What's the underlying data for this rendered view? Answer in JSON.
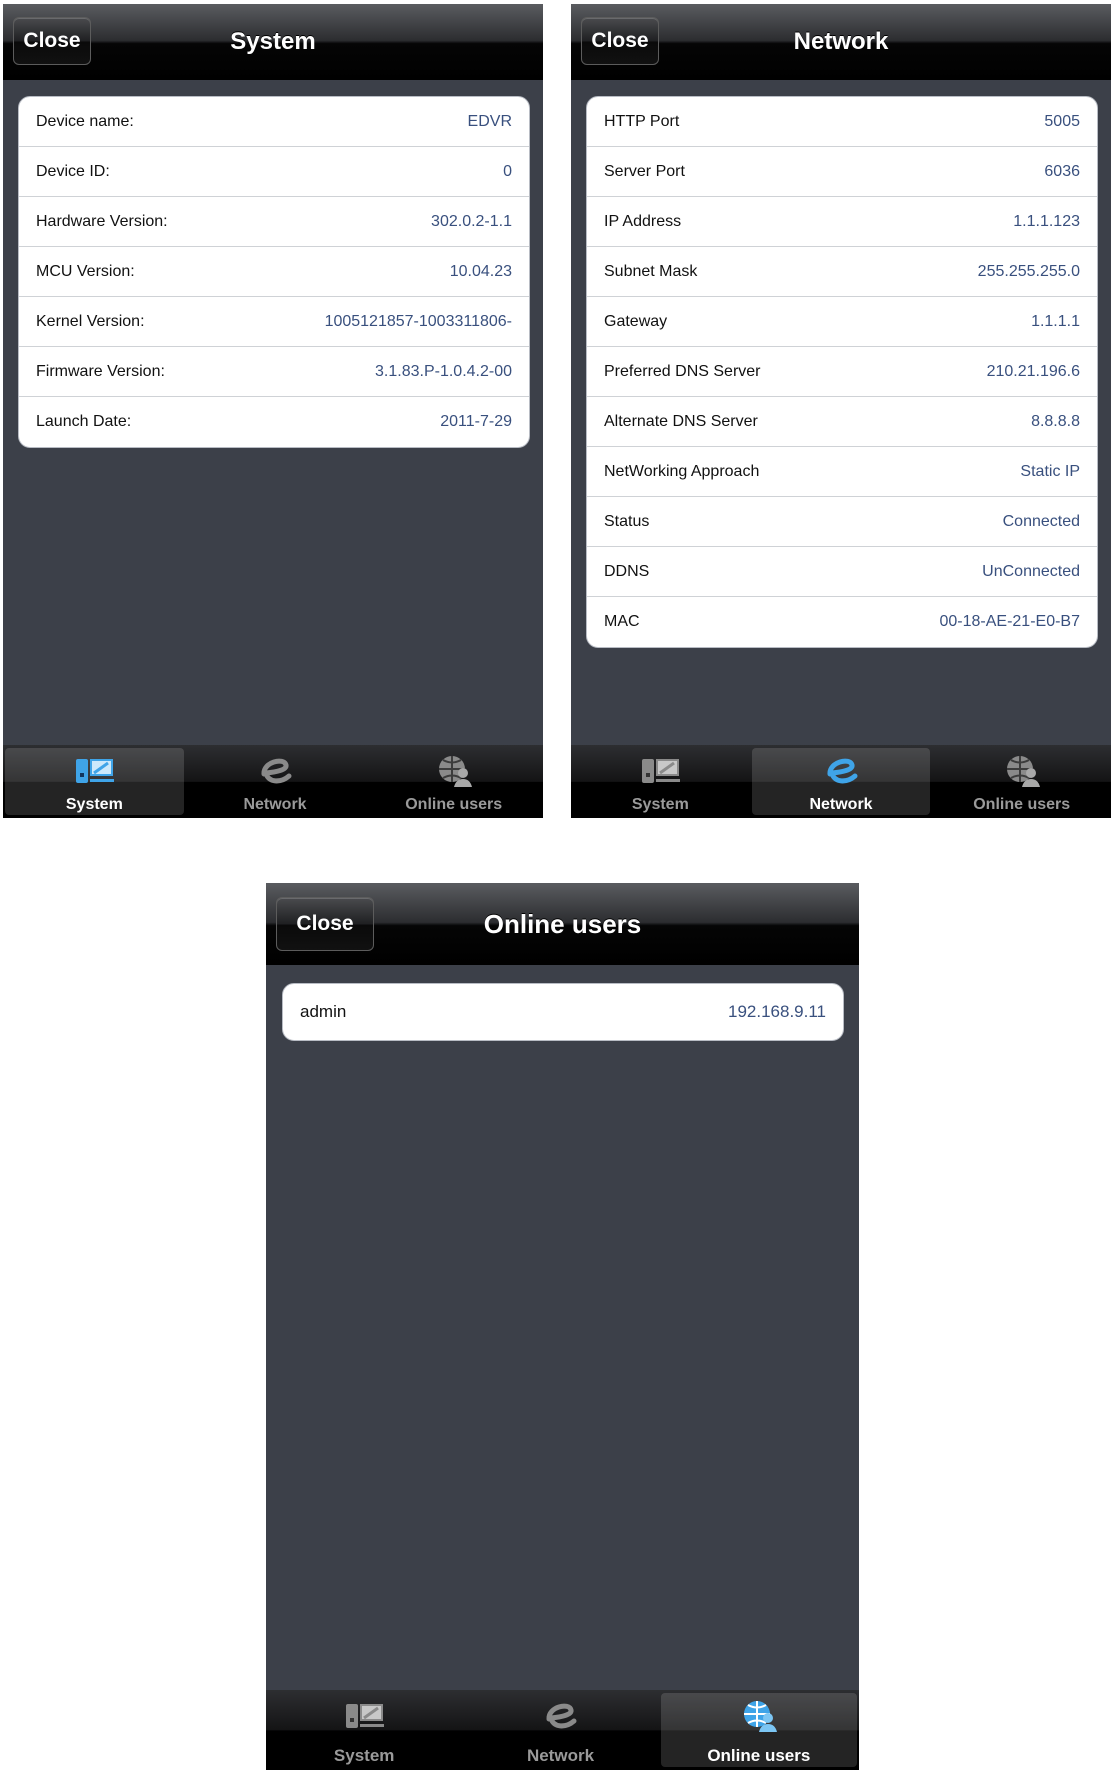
{
  "close_label": "Close",
  "tabs": {
    "system": "System",
    "network": "Network",
    "online_users": "Online users"
  },
  "system_screen": {
    "title": "System",
    "rows": [
      {
        "label": "Device name:",
        "value": "EDVR"
      },
      {
        "label": "Device ID:",
        "value": "0"
      },
      {
        "label": "Hardware Version:",
        "value": "302.0.2-1.1"
      },
      {
        "label": "MCU Version:",
        "value": "10.04.23"
      },
      {
        "label": "Kernel Version:",
        "value": "1005121857-1003311806-"
      },
      {
        "label": "Firmware Version:",
        "value": "3.1.83.P-1.0.4.2-00"
      },
      {
        "label": "Launch Date:",
        "value": "2011-7-29"
      }
    ]
  },
  "network_screen": {
    "title": "Network",
    "rows": [
      {
        "label": "HTTP Port",
        "value": "5005"
      },
      {
        "label": "Server Port",
        "value": "6036"
      },
      {
        "label": "IP Address",
        "value": "1.1.1.123"
      },
      {
        "label": "Subnet Mask",
        "value": "255.255.255.0"
      },
      {
        "label": "Gateway",
        "value": "1.1.1.1"
      },
      {
        "label": "Preferred DNS Server",
        "value": "210.21.196.6"
      },
      {
        "label": "Alternate DNS Server",
        "value": "8.8.8.8"
      },
      {
        "label": "NetWorking Approach",
        "value": "Static IP"
      },
      {
        "label": "Status",
        "value": "Connected"
      },
      {
        "label": "DDNS",
        "value": "UnConnected"
      },
      {
        "label": "MAC",
        "value": "00-18-AE-21-E0-B7"
      }
    ]
  },
  "users_screen": {
    "title": "Online users",
    "rows": [
      {
        "label": "admin",
        "value": "192.168.9.11"
      }
    ]
  },
  "colors": {
    "background": "#3c4049",
    "value_text": "#39507e",
    "active_tab_icon": "#3fa4e8",
    "inactive_tab_icon": "#8a8a8a"
  },
  "icons": {
    "system": "computer-monitor-icon",
    "network": "e-network-icon",
    "online_users": "globe-user-icon"
  }
}
